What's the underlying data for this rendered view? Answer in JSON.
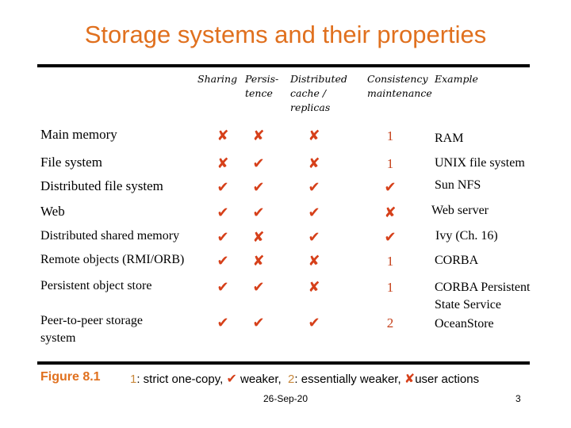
{
  "title": "Storage systems and their properties",
  "colors": {
    "title": "#e0701e",
    "mark": "#d6401a",
    "legend_number": "#c8883c"
  },
  "icons": {
    "yes": "check-icon",
    "no": "cross-icon"
  },
  "symbols": {
    "yes": "✔",
    "no": "✘"
  },
  "columns": [
    {
      "key": "sharing",
      "label": "Sharing"
    },
    {
      "key": "persistence",
      "label": "Persis-\ntence"
    },
    {
      "key": "distributed_cache",
      "label": "Distributed\ncache /\nreplicas"
    },
    {
      "key": "consistency",
      "label": "Consistency\nmaintenance"
    },
    {
      "key": "example",
      "label": "Example"
    }
  ],
  "rows": [
    {
      "name": "Main memory",
      "sharing": "no",
      "persistence": "no",
      "distributed_cache": "no",
      "consistency": "1",
      "example": "RAM"
    },
    {
      "name": "File system",
      "sharing": "no",
      "persistence": "yes",
      "distributed_cache": "no",
      "consistency": "1",
      "example": "UNIX file system"
    },
    {
      "name": "Distributed file system",
      "sharing": "yes",
      "persistence": "yes",
      "distributed_cache": "yes",
      "consistency": "yes",
      "example": "Sun NFS"
    },
    {
      "name": "Web",
      "sharing": "yes",
      "persistence": "yes",
      "distributed_cache": "yes",
      "consistency": "no",
      "example": "Web server"
    },
    {
      "name": "Distributed shared memory",
      "sharing": "yes",
      "persistence": "no",
      "distributed_cache": "yes",
      "consistency": "yes",
      "example": "Ivy (Ch. 16)"
    },
    {
      "name": "Remote objects (RMI/ORB)",
      "sharing": "yes",
      "persistence": "no",
      "distributed_cache": "no",
      "consistency": "1",
      "example": "CORBA"
    },
    {
      "name": "Persistent object store",
      "sharing": "yes",
      "persistence": "yes",
      "distributed_cache": "no",
      "consistency": "1",
      "example": "CORBA Persistent\nState Service"
    },
    {
      "name": "Peer-to-peer storage\nsystem",
      "sharing": "yes",
      "persistence": "yes",
      "distributed_cache": "yes",
      "consistency": "2",
      "example": "OceanStore"
    }
  ],
  "footer": {
    "figure_label": "Figure 8.1",
    "legend": {
      "one": "1",
      "one_text": ": strict one-copy, ",
      "check_text": " weaker,  ",
      "two": "2",
      "two_text": ": essentially weaker, ",
      "cross_text": "user actions"
    },
    "date": "26-Sep-20",
    "page_number": "3"
  }
}
